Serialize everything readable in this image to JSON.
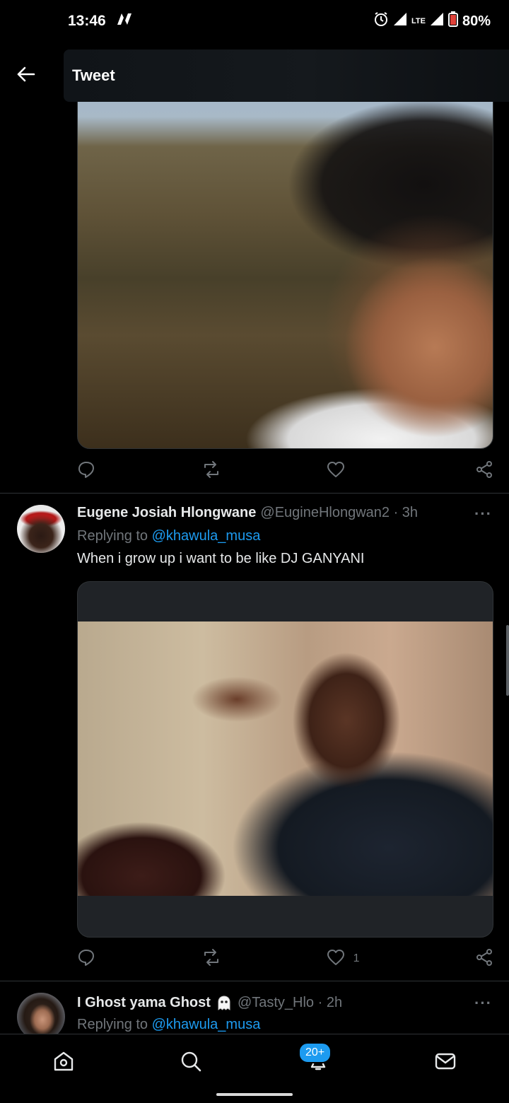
{
  "status_bar": {
    "time": "13:46",
    "carrier_icon": "n-logo-icon",
    "network": "LTE",
    "battery": "80%"
  },
  "header": {
    "title": "Tweet"
  },
  "tweet1_actions": {
    "like_count": ""
  },
  "tweet2": {
    "name": "Eugene Josiah Hlongwane",
    "handle": "@EugineHlongwan2 · 3h",
    "replying_prefix": "Replying to",
    "mention": "@khawula_musa",
    "text": "When i grow up i want to be like DJ GANYANI",
    "like_count": "1",
    "more": "···"
  },
  "tweet3": {
    "name": "I Ghost yama Ghost",
    "emoji_icon": "ghost-icon",
    "handle": "@Tasty_Hlo · 2h",
    "replying_prefix": "Replying to",
    "mention": "@khawula_musa",
    "more": "···"
  },
  "bottom_nav": {
    "notifications_badge": "20+",
    "items": [
      "home-icon",
      "search-icon",
      "notifications-icon",
      "messages-icon"
    ]
  },
  "colors": {
    "background": "#000000",
    "accent": "#1d9bf0",
    "secondary_text": "#71767b",
    "divider": "#2f3336"
  }
}
